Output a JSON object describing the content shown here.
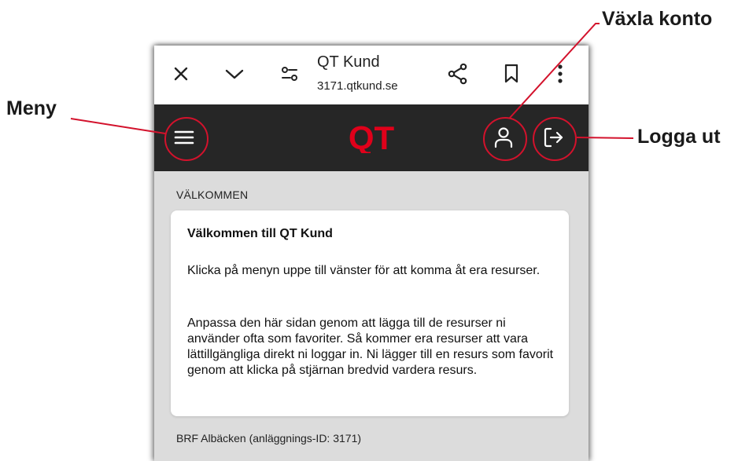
{
  "browser": {
    "title": "QT Kund",
    "url": "3171.qtkund.se",
    "icons": [
      "close-icon",
      "chevron-down-icon",
      "site-settings-icon",
      "share-icon",
      "bookmark-icon",
      "more-vert-icon"
    ]
  },
  "app": {
    "logo_text": "QT",
    "brand_color": "#e0001a",
    "header_color": "#262626",
    "icons": [
      "hamburger-menu-icon",
      "user-icon",
      "logout-icon"
    ]
  },
  "content": {
    "section_label": "VÄLKOMMEN",
    "card": {
      "title": "Välkommen till QT Kund",
      "paragraph1": "Klicka på menyn uppe till vänster för att komma åt era resurser.",
      "paragraph2": "Anpassa den här sidan genom att lägga till de resurser ni använder ofta som favoriter. Så kommer era resurser att vara lättillgängliga direkt ni loggar in. Ni lägger till en resurs som favorit genom att klicka på stjärnan bredvid vardera resurs."
    },
    "footer": "BRF Albäcken (anläggnings-ID: 3171)"
  },
  "annotations": {
    "menu": "Meny",
    "switch_account": "Växla konto",
    "logout": "Logga ut",
    "highlight_color": "#d3122c"
  }
}
